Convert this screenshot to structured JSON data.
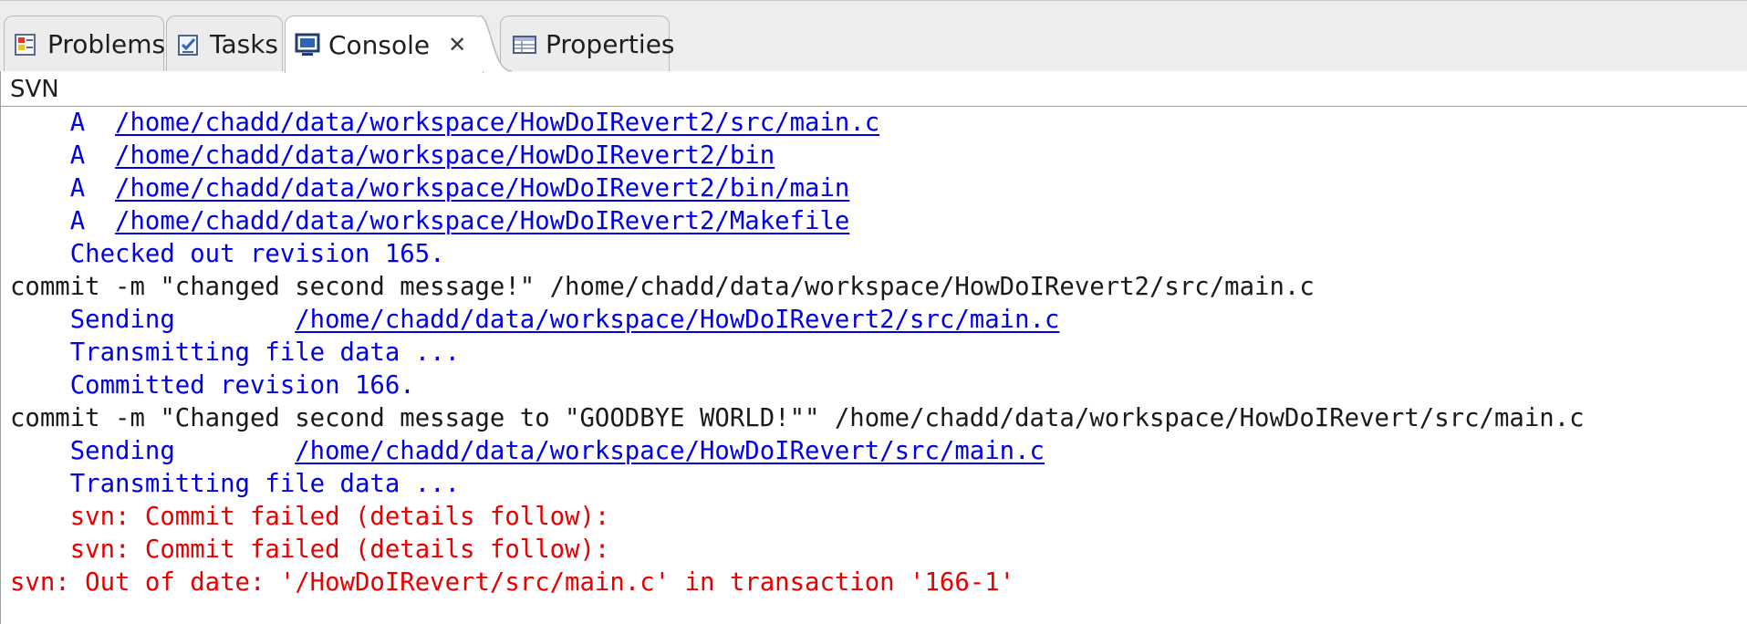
{
  "tabs": {
    "problems": "Problems",
    "tasks": "Tasks",
    "console": "Console",
    "console_close": "✕",
    "properties": "Properties"
  },
  "console": {
    "name": "SVN",
    "lines": [
      {
        "prefix": "    A  ",
        "link": "/home/chadd/data/workspace/HowDoIRevert2/src/main.c",
        "suffix": ""
      },
      {
        "prefix": "    A  ",
        "link": "/home/chadd/data/workspace/HowDoIRevert2/bin",
        "suffix": ""
      },
      {
        "prefix": "    A  ",
        "link": "/home/chadd/data/workspace/HowDoIRevert2/bin/main",
        "suffix": ""
      },
      {
        "prefix": "    A  ",
        "link": "/home/chadd/data/workspace/HowDoIRevert2/Makefile",
        "suffix": ""
      },
      {
        "text": "    Checked out revision 165."
      },
      {
        "text": "commit -m \"changed second message!\" /home/chadd/data/workspace/HowDoIRevert2/src/main.c"
      },
      {
        "prefix": "    Sending        ",
        "link": "/home/chadd/data/workspace/HowDoIRevert2/src/main.c",
        "suffix": ""
      },
      {
        "text": "    Transmitting file data ..."
      },
      {
        "text": "    Committed revision 166."
      },
      {
        "text": "commit -m \"Changed second message to \"GOODBYE WORLD!\"\" /home/chadd/data/workspace/HowDoIRevert/src/main.c"
      },
      {
        "prefix": "    Sending        ",
        "link": "/home/chadd/data/workspace/HowDoIRevert/src/main.c",
        "suffix": ""
      },
      {
        "text": "    Transmitting file data ..."
      },
      {
        "text": "    svn: Commit failed (details follow):"
      },
      {
        "text": "    svn: Commit failed (details follow):"
      },
      {
        "text": "svn: Out of date: '/HowDoIRevert/src/main.c' in transaction '166-1'"
      }
    ]
  },
  "colors": {
    "output_blue": "#0000e6",
    "command_black": "#1a1a1a",
    "error_red": "#e60000"
  }
}
